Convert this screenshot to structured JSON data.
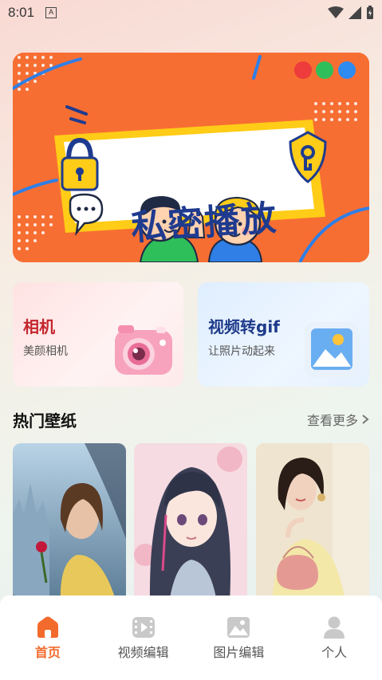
{
  "status_bar": {
    "time": "8:01",
    "notification_badge": "A"
  },
  "banner": {
    "title": "私密播放",
    "dot_colors": [
      "#ee3b3b",
      "#2fbf5a",
      "#2f8bf0"
    ]
  },
  "feature_cards": [
    {
      "title": "相机",
      "subtitle": "美颜相机"
    },
    {
      "title": "视频转gif",
      "subtitle": "让照片动起来"
    }
  ],
  "wallpapers": {
    "title": "热门壁纸",
    "more_label": "查看更多",
    "items": [
      "wallpaper-castle-rose",
      "wallpaper-anime-girl",
      "wallpaper-woman-pink-bag"
    ]
  },
  "tabbar": {
    "items": [
      {
        "label": "首页",
        "icon": "home-icon",
        "active": true
      },
      {
        "label": "视频编辑",
        "icon": "video-edit-icon",
        "active": false
      },
      {
        "label": "图片编辑",
        "icon": "image-edit-icon",
        "active": false
      },
      {
        "label": "个人",
        "icon": "person-icon",
        "active": false
      }
    ]
  },
  "colors": {
    "accent": "#f26a2c",
    "banner_bg": "#f76e33",
    "banner_title": "#1f3b8f",
    "camera_title": "#c4262e",
    "gif_title": "#1e3a8a"
  }
}
